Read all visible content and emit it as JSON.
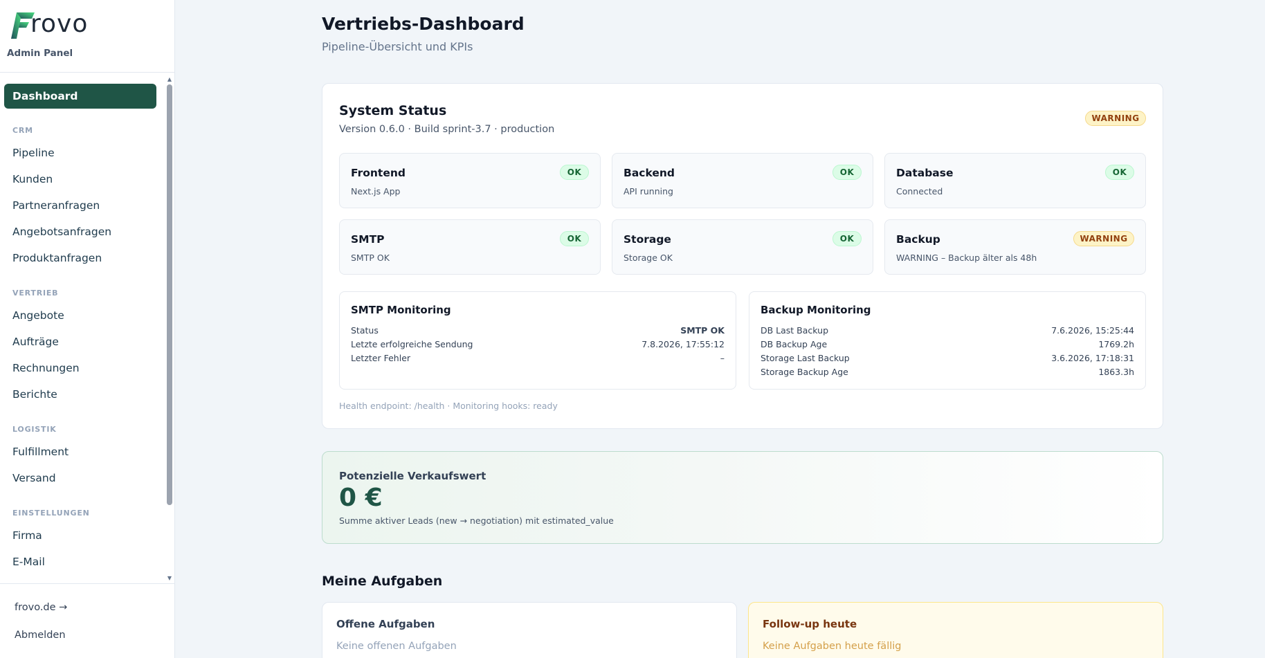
{
  "brand": {
    "logo_text": "rovo",
    "panel_label": "Admin Panel"
  },
  "sidebar": {
    "active": "Dashboard",
    "sections": [
      {
        "label": "CRM",
        "items": [
          "Pipeline",
          "Kunden",
          "Partneranfragen",
          "Angebotsanfragen",
          "Produktanfragen"
        ]
      },
      {
        "label": "VERTRIEB",
        "items": [
          "Angebote",
          "Aufträge",
          "Rechnungen",
          "Berichte"
        ]
      },
      {
        "label": "LOGISTIK",
        "items": [
          "Fulfillment",
          "Versand"
        ]
      },
      {
        "label": "EINSTELLUNGEN",
        "items": [
          "Firma",
          "E-Mail"
        ]
      }
    ],
    "footer": {
      "site_link": "frovo.de →",
      "logout": "Abmelden"
    }
  },
  "header": {
    "title": "Vertriebs-Dashboard",
    "subtitle": "Pipeline-Übersicht und KPIs"
  },
  "system_status": {
    "title": "System Status",
    "version_line": "Version 0.6.0 · Build sprint-3.7 · production",
    "overall_status": "WARNING",
    "services": [
      {
        "name": "Frontend",
        "desc": "Next.js App",
        "status": "OK"
      },
      {
        "name": "Backend",
        "desc": "API running",
        "status": "OK"
      },
      {
        "name": "Database",
        "desc": "Connected",
        "status": "OK"
      },
      {
        "name": "SMTP",
        "desc": "SMTP OK",
        "status": "OK"
      },
      {
        "name": "Storage",
        "desc": "Storage OK",
        "status": "OK"
      },
      {
        "name": "Backup",
        "desc": "WARNING – Backup älter als 48h",
        "status": "WARNING"
      }
    ],
    "smtp_monitoring": {
      "title": "SMTP Monitoring",
      "rows": [
        {
          "key": "Status",
          "value": "SMTP OK"
        },
        {
          "key": "Letzte erfolgreiche Sendung",
          "value": "7.8.2026, 17:55:12"
        },
        {
          "key": "Letzter Fehler",
          "value": "–"
        }
      ]
    },
    "backup_monitoring": {
      "title": "Backup Monitoring",
      "rows": [
        {
          "key": "DB Last Backup",
          "value": "7.6.2026, 15:25:44"
        },
        {
          "key": "DB Backup Age",
          "value": "1769.2h"
        },
        {
          "key": "Storage Last Backup",
          "value": "3.6.2026, 17:18:31"
        },
        {
          "key": "Storage Backup Age",
          "value": "1863.3h"
        }
      ]
    },
    "health_line": "Health endpoint: /health · Monitoring hooks: ready"
  },
  "sales_value": {
    "label": "Potenzielle Verkaufswert",
    "value": "0 €",
    "note": "Summe aktiver Leads (new → negotiation) mit estimated_value"
  },
  "tasks": {
    "title": "Meine Aufgaben",
    "open": {
      "title": "Offene Aufgaben",
      "empty": "Keine offenen Aufgaben"
    },
    "followup": {
      "title": "Follow-up heute",
      "empty": "Keine Aufgaben heute fällig"
    }
  },
  "colors": {
    "accent": "#1f5546",
    "warning_bg": "#fdf3c7",
    "ok_bg": "#dcfce7"
  }
}
